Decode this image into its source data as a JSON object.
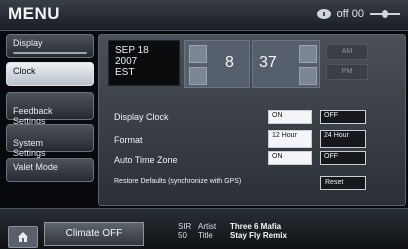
{
  "header": {
    "title": "MENU",
    "status_value": "off 00"
  },
  "sidebar": {
    "items": [
      {
        "label": "Display"
      },
      {
        "label": "Clock"
      },
      {
        "label": "Feedback\nSettings"
      },
      {
        "label": "System\nSettings"
      },
      {
        "label": "Valet Mode"
      }
    ]
  },
  "clock": {
    "date_line1": "SEP 18",
    "date_line2": "2007",
    "date_line3": "EST",
    "hour": "8",
    "minute": "37",
    "am_label": "AM",
    "pm_label": "PM"
  },
  "settings": {
    "display_clock": {
      "label": "Display Clock",
      "on": "ON",
      "off": "OFF"
    },
    "format": {
      "label": "Format",
      "opt12": "12 Hour",
      "opt24": "24 Hour"
    },
    "auto_tz": {
      "label": "Auto Time Zone",
      "on": "ON",
      "off": "OFF"
    },
    "restore": {
      "label": "Restore Defaults (synchronize with GPS)",
      "reset": "Reset"
    }
  },
  "bottom": {
    "climate": "Climate OFF",
    "media_left1": "SIR",
    "media_left2": "50",
    "artist_label": "Artist",
    "artist_value": "Three 6 Mafia",
    "title_label": "Title",
    "title_value": "Stay Fly Remix"
  }
}
